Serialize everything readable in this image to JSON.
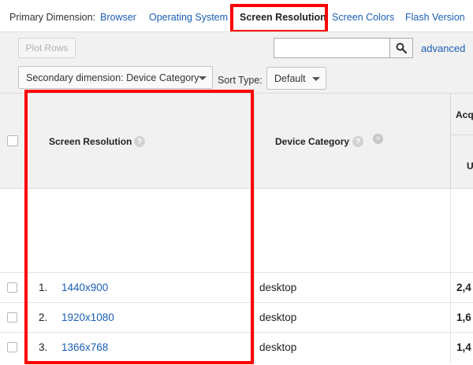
{
  "dimension_bar": {
    "label": "Primary Dimension:",
    "options": [
      {
        "label": "Browser",
        "active": false
      },
      {
        "label": "Operating System",
        "active": false
      },
      {
        "label": "Screen Resolution",
        "active": true
      },
      {
        "label": "Screen Colors",
        "active": false
      },
      {
        "label": "Flash Version",
        "active": false
      }
    ]
  },
  "toolbar": {
    "plot_rows": "Plot Rows",
    "search_value": "",
    "search_icon": "search-icon",
    "advanced": "advanced",
    "secondary_dimension": "Secondary dimension: Device Category",
    "sort_type_label": "Sort Type:",
    "sort_type_value": "Default"
  },
  "table": {
    "headers": {
      "screen_resolution": "Screen Resolution",
      "device_category": "Device Category",
      "acquisition": "Acq",
      "users": "U",
      "help_glyph": "?"
    },
    "rows": [
      {
        "index": "1.",
        "resolution": "1440x900",
        "device": "desktop",
        "value": "2,4"
      },
      {
        "index": "2.",
        "resolution": "1920x1080",
        "device": "desktop",
        "value": "1,6"
      },
      {
        "index": "3.",
        "resolution": "1366x768",
        "device": "desktop",
        "value": "1,4"
      }
    ]
  },
  "colors": {
    "link": "#1a5fb4",
    "highlight": "#ff0000",
    "header_bg": "#f1f1f1"
  }
}
